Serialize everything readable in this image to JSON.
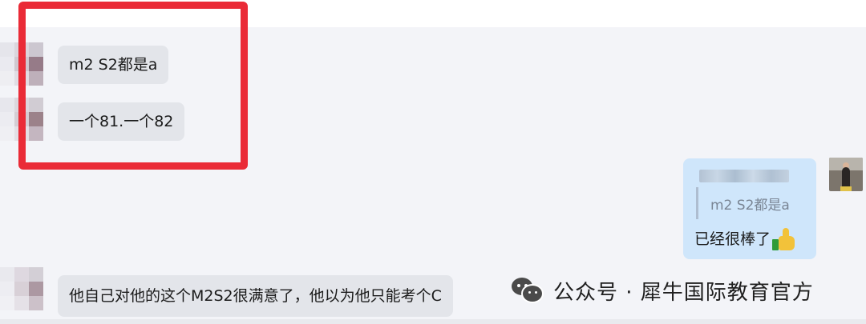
{
  "messages": [
    {
      "sender": "other",
      "text": "m2 S2都是a"
    },
    {
      "sender": "other",
      "text": "一个81.一个82"
    },
    {
      "sender": "self",
      "quoted_text": "m2 S2都是a",
      "text": "已经很棒了",
      "emoji": "thumbs-up-icon"
    },
    {
      "sender": "other",
      "text": "他自己对他的这个M2S2很满意了，他以为他只能考个C"
    }
  ],
  "highlight": {
    "color": "#ea2b37"
  },
  "watermark": {
    "icon": "wechat-icon",
    "text": "公众号 · 犀牛国际教育官方"
  },
  "colors": {
    "incoming_bubble": "#e3e5ea",
    "outgoing_bubble": "#cfe6fb",
    "background": "#f3f4f8"
  }
}
